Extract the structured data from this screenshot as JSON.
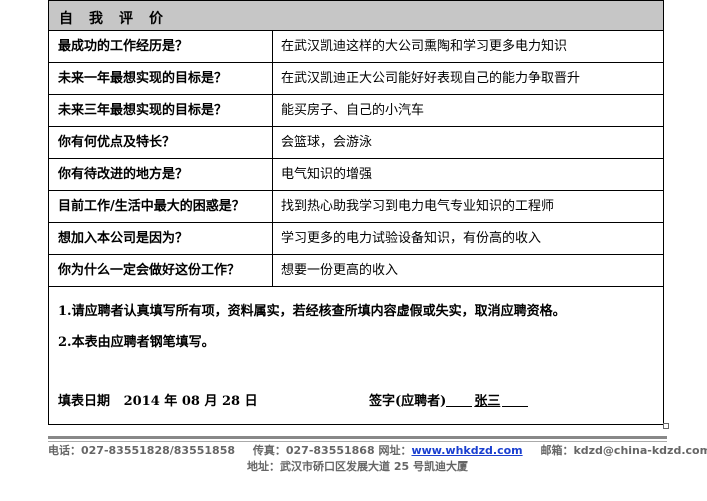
{
  "form": {
    "header": "自我评价",
    "rows": [
      {
        "q": "最成功的工作经历是？",
        "a": "在武汉凯迪这样的大公司熏陶和学习更多电力知识"
      },
      {
        "q": "未来一年最想实现的目标是？",
        "a": "在武汉凯迪正大公司能好好表现自己的能力争取晋升"
      },
      {
        "q": "未来三年最想实现的目标是？",
        "a": "能买房子、自己的小汽车"
      },
      {
        "q": "你有何优点及特长？",
        "a": "会篮球，会游泳"
      },
      {
        "q": "你有待改进的地方是？",
        "a": "电气知识的增强"
      },
      {
        "q": "目前工作/生活中最大的困惑是？",
        "a": "找到热心助我学习到电力电气专业知识的工程师"
      },
      {
        "q": "想加入本公司是因为？",
        "a": "学习更多的电力试验设备知识，有份高的收入"
      },
      {
        "q": "你为什么一定会做好这份工作？",
        "a": "想要一份更高的收入"
      }
    ],
    "notes": [
      "1.请应聘者认真填写所有项，资料属实，若经核查所填内容虚假或失实，取消应聘资格。",
      "2.本表由应聘者钢笔填写。"
    ],
    "date_label": "填表日期",
    "date_value": "2014 年 08 月 28 日",
    "sign_label": "签字(应聘者)",
    "sign_name": "张三"
  },
  "footer": {
    "phone": "电话：027-83551828/83551858",
    "fax": "传真：027-83551868",
    "web_label": "网址：",
    "web_url": "www.whkdzd.com",
    "email": "邮箱：kdzd@china-kdzd.com",
    "address": "地址：武汉市硚口区发展大道 25 号凯迪大厦"
  }
}
